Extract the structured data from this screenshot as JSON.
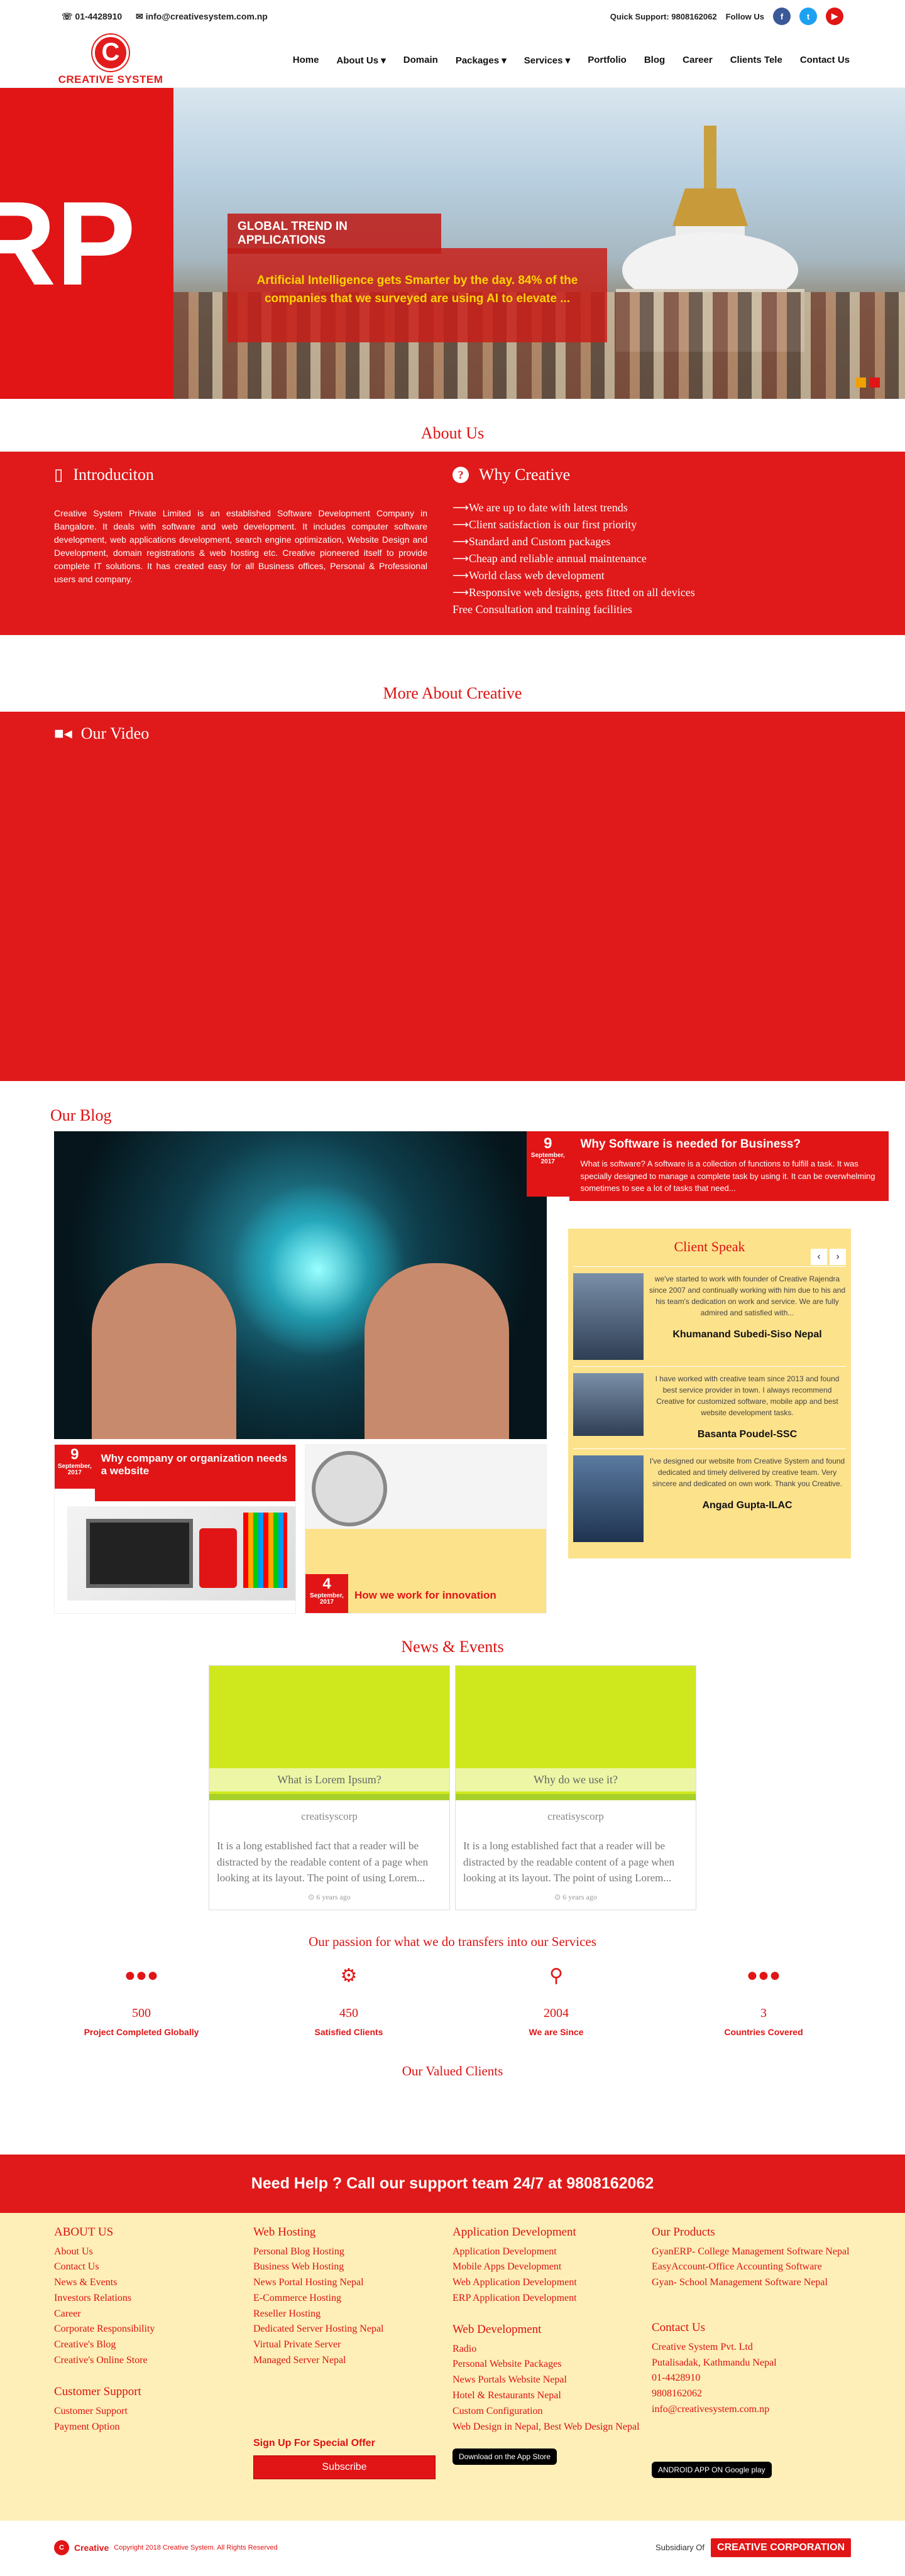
{
  "topbar": {
    "phone": "01-4428910",
    "email": "info@creativesystem.com.np",
    "support": "Quick Support: 9808162062",
    "follow": "Follow Us"
  },
  "logo": {
    "name": "CREATIVE SYSTEM",
    "mark": "C"
  },
  "menu": [
    "Home",
    "About Us",
    "Domain",
    "Packages",
    "Services",
    "Portfolio",
    "Blog",
    "Career",
    "Clients Tele",
    "Contact Us"
  ],
  "hero": {
    "big": "RP",
    "title": "GLOBAL TREND IN APPLICATIONS",
    "text": "Artificial Intelligence gets Smarter by the day. 84% of the companies that we surveyed are using AI to elevate ..."
  },
  "about": {
    "title": "About Us",
    "intro_title": "Introduciton",
    "intro_text": "Creative System Private Limited is an established Software Development Company in Bangalore. It deals with software and web development. It includes computer software development, web applications development, search engine optimization, Website Design and Development, domain registrations & web hosting etc. Creative pioneered itself to provide complete IT solutions. It has created easy for all Business offices, Personal & Professional users and company.",
    "why_title": "Why Creative",
    "why_items": [
      "We are up to date with latest trends",
      "Client satisfaction is our first priority",
      "Standard and Custom packages",
      "Cheap and reliable annual maintenance",
      "World class web development",
      "Responsive web designs, gets fitted on all devices",
      "Free Consultation and training facilities"
    ]
  },
  "more": {
    "title": "More About Creative",
    "video": "Our Video"
  },
  "blog": {
    "title": "Our Blog",
    "featured": {
      "day": "9",
      "month": "September, 2017",
      "title": "Why Software is needed for Business?",
      "text": "What is software? A software is a collection of functions to fulfill a task. It was specially designed to manage a complete task by using it. It can be overwhelming sometimes to see a lot of tasks that need..."
    },
    "card1": {
      "day": "9",
      "month": "September, 2017",
      "title": "Why company or organization needs a website"
    },
    "card2": {
      "day": "4",
      "month": "September, 2017",
      "title": "How we work for innovation"
    }
  },
  "clients": {
    "title": "Client Speak",
    "items": [
      {
        "text": "we've started to work with founder of Creative Rajendra since 2007 and continually working with him due to his and his team's dedication on work and service. We are fully admired and satisfied with...",
        "name": "Khumanand Subedi-Siso Nepal"
      },
      {
        "text": "I have worked with creative team since 2013 and found best service provider in town. I always recommend Creative for customized software, mobile app and best website development tasks.",
        "name": "Basanta Poudel-SSC"
      },
      {
        "text": "I've designed our website from Creative System and found dedicated and timely delivered by creative team. Very sincere and dedicated on own work. Thank you Creative.",
        "name": "Angad Gupta-ILAC"
      }
    ]
  },
  "news": {
    "title": "News & Events",
    "items": [
      {
        "cap": "What is Lorem Ipsum?",
        "by": "creatisyscorp",
        "text": "It is a long established fact that a reader will be distracted by the readable content of a page when looking at its layout. The point of using Lorem...",
        "ago": "6 years ago"
      },
      {
        "cap": "Why do we use it?",
        "by": "creatisyscorp",
        "text": "It is a long established fact that a reader will be distracted by the readable content of a page when looking at its layout. The point of using Lorem...",
        "ago": "6 years ago"
      }
    ]
  },
  "passion": "Our passion for what we do transfers into our Services",
  "stats": [
    {
      "num": "500",
      "label": "Project Completed Globally"
    },
    {
      "num": "450",
      "label": "Satisfied Clients"
    },
    {
      "num": "2004",
      "label": "We are Since"
    },
    {
      "num": "3",
      "label": "Countries Covered"
    }
  ],
  "valued": "Our Valued Clients",
  "help": "Need Help ? Call our support team 24/7 at 9808162062",
  "footer": {
    "about_title": "ABOUT US",
    "about": [
      "About Us",
      "Contact Us",
      "News & Events",
      "Investors Relations",
      "Career",
      "Corporate Responsibility",
      "Creative's Blog",
      "Creative's Online Store"
    ],
    "support_title": "Customer Support",
    "support": [
      "Customer Support",
      "Payment Option"
    ],
    "hosting_title": "Web Hosting",
    "hosting": [
      "Personal Blog Hosting",
      "Business Web Hosting",
      "News Portal Hosting Nepal",
      "E-Commerce Hosting",
      "Reseller Hosting",
      "Dedicated Server Hosting Nepal",
      "Virtual Private Server",
      "Managed Server Nepal"
    ],
    "signup_title": "Sign Up For Special Offer",
    "signup_btn": "Subscribe",
    "app_title": "Application Development",
    "app": [
      "Application Development",
      "Mobile Apps Development",
      "Web Application Development",
      "ERP Application Development"
    ],
    "webdev_title": "Web Development",
    "webdev": [
      "Radio",
      "Personal Website Packages",
      "News Portals Website Nepal",
      "Hotel & Restaurants Nepal",
      "Custom Configuration",
      "Web Design in Nepal, Best Web Design Nepal"
    ],
    "appstore": "Download on the App Store",
    "products_title": "Our Products",
    "products": [
      "GyanERP- College Management Software Nepal",
      "EasyAccount-Office Accounting Software",
      "Gyan- School Management Software Nepal"
    ],
    "contact_title": "Contact Us",
    "contact": [
      "Creative System Pvt. Ltd",
      "Putalisadak, Kathmandu Nepal",
      "01-4428910",
      "9808162062",
      "info@creativesystem.com.np"
    ],
    "googleplay": "ANDROID APP ON Google play"
  },
  "bottom": {
    "copyright": "Copyright 2018 Creative System. All Rights Reserved",
    "subsidiary": "Subsidiary Of",
    "corp": "CREATIVE CORPORATION",
    "mini_logo": "Creative"
  }
}
